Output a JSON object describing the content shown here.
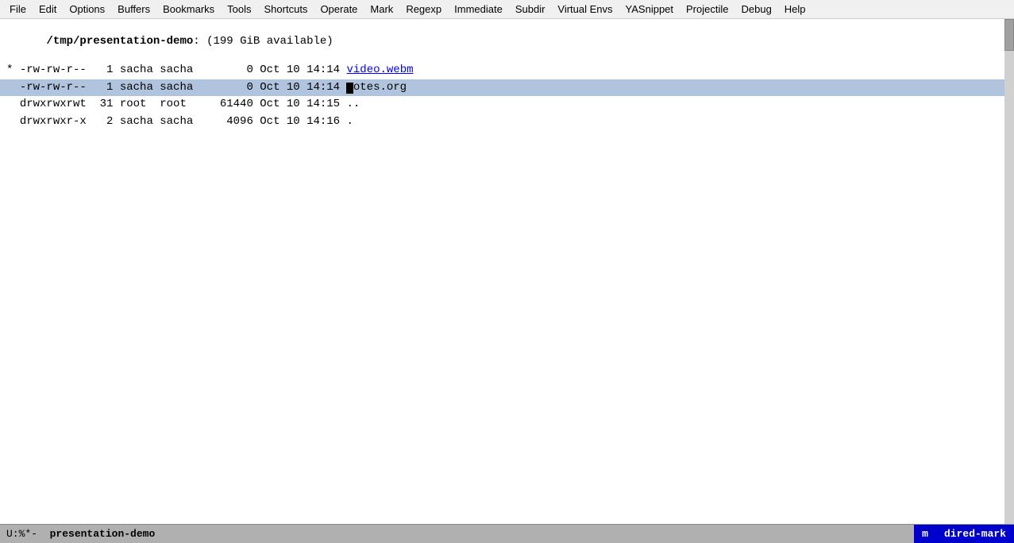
{
  "menubar": {
    "items": [
      {
        "label": "File",
        "name": "menu-file"
      },
      {
        "label": "Edit",
        "name": "menu-edit"
      },
      {
        "label": "Options",
        "name": "menu-options"
      },
      {
        "label": "Buffers",
        "name": "menu-buffers"
      },
      {
        "label": "Bookmarks",
        "name": "menu-bookmarks"
      },
      {
        "label": "Tools",
        "name": "menu-tools"
      },
      {
        "label": "Shortcuts",
        "name": "menu-shortcuts"
      },
      {
        "label": "Operate",
        "name": "menu-operate"
      },
      {
        "label": "Mark",
        "name": "menu-mark"
      },
      {
        "label": "Regexp",
        "name": "menu-regexp"
      },
      {
        "label": "Immediate",
        "name": "menu-immediate"
      },
      {
        "label": "Subdir",
        "name": "menu-subdir"
      },
      {
        "label": "Virtual Envs",
        "name": "menu-virtual-envs"
      },
      {
        "label": "YASnippet",
        "name": "menu-yasnippet"
      },
      {
        "label": "Projectile",
        "name": "menu-projectile"
      },
      {
        "label": "Debug",
        "name": "menu-debug"
      },
      {
        "label": "Help",
        "name": "menu-help"
      }
    ]
  },
  "editor": {
    "header": {
      "path": "/tmp/presentation-demo",
      "info": "(199 GiB available)"
    },
    "rows": [
      {
        "marker": "*",
        "permissions": "-rw-rw-r--",
        "links": "1",
        "owner": "sacha",
        "group": "sacha",
        "size": "0",
        "month": "Oct",
        "day": "10",
        "time": "14:14",
        "filename": "video.webm",
        "filename_type": "link",
        "selected": false,
        "marked": true
      },
      {
        "marker": " ",
        "permissions": "-rw-rw-r--",
        "links": "1",
        "owner": "sacha",
        "group": "sacha",
        "size": "0",
        "month": "Oct",
        "day": "10",
        "time": "14:14",
        "filename": "notes.org",
        "filename_type": "org",
        "selected": true,
        "marked": false,
        "cursor_pos": 0
      },
      {
        "marker": " ",
        "permissions": "drwxrwxrwt",
        "links": "31",
        "owner": "root",
        "group": "root",
        "size": "61440",
        "month": "Oct",
        "day": "10",
        "time": "14:15",
        "filename": "..",
        "filename_type": "dir",
        "selected": false,
        "marked": false
      },
      {
        "marker": " ",
        "permissions": "drwxrwxr-x",
        "links": "2",
        "owner": "sacha",
        "group": "sacha",
        "size": "4096",
        "month": "Oct",
        "day": "10",
        "time": "14:16",
        "filename": ".",
        "filename_type": "dir",
        "selected": false,
        "marked": false
      }
    ]
  },
  "statusbar": {
    "left_text": "U:%*-  presentation-demo",
    "mode_key": "m",
    "mode_name": "dired-mark"
  }
}
